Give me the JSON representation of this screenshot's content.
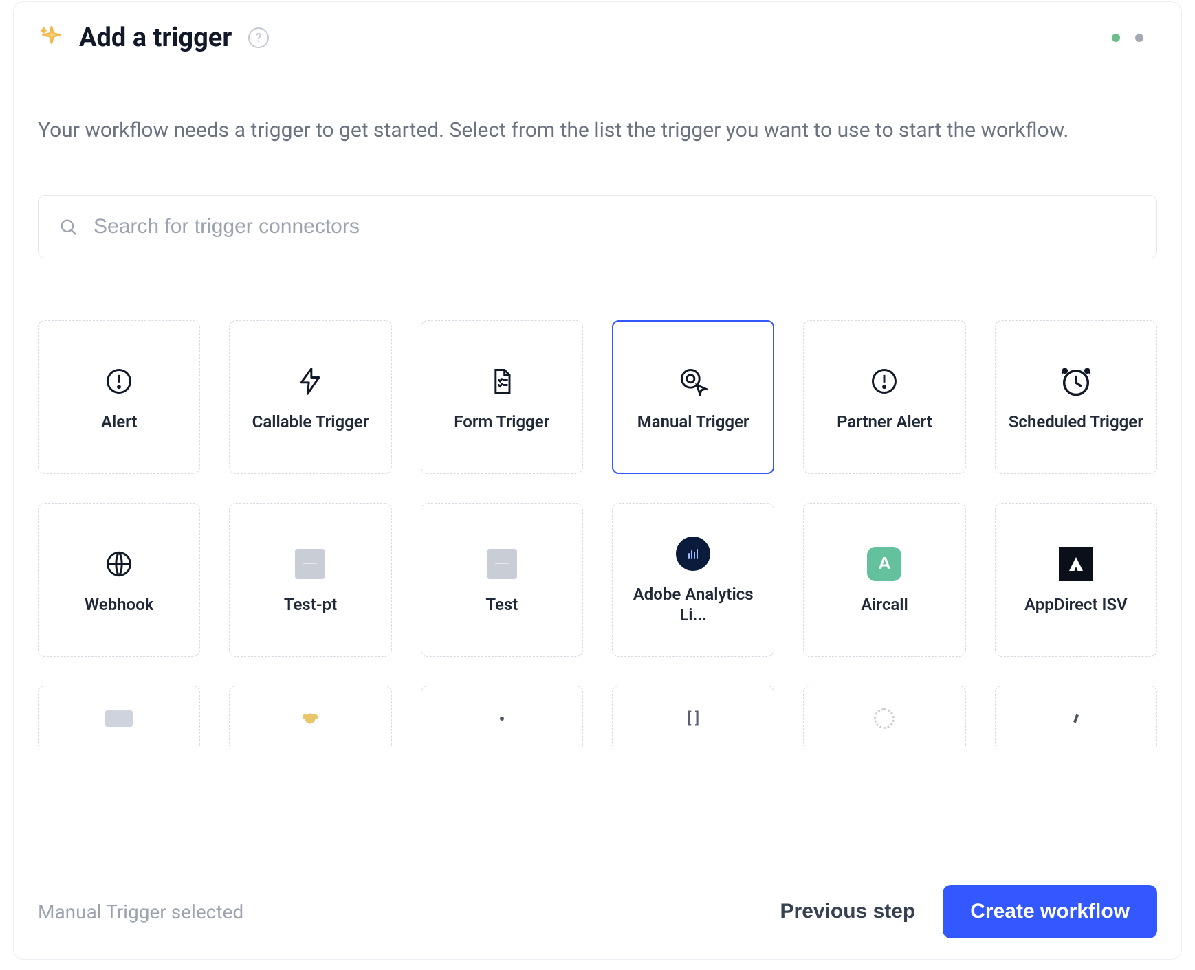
{
  "header": {
    "title": "Add a trigger",
    "description": "Your workflow needs a trigger to get started. Select from the list the trigger you want to use to start the workflow."
  },
  "search": {
    "placeholder": "Search for trigger connectors"
  },
  "triggers": [
    {
      "id": "alert",
      "label": "Alert",
      "icon": "alert-icon",
      "selected": false
    },
    {
      "id": "callable",
      "label": "Callable Trigger",
      "icon": "bolt-icon",
      "selected": false
    },
    {
      "id": "form",
      "label": "Form Trigger",
      "icon": "form-icon",
      "selected": false
    },
    {
      "id": "manual",
      "label": "Manual Trigger",
      "icon": "cursor-icon",
      "selected": true
    },
    {
      "id": "partner-alert",
      "label": "Partner Alert",
      "icon": "alert-icon",
      "selected": false
    },
    {
      "id": "scheduled",
      "label": "Scheduled Trigger",
      "icon": "clock-icon",
      "selected": false
    },
    {
      "id": "webhook",
      "label": "Webhook",
      "icon": "globe-icon",
      "selected": false
    },
    {
      "id": "test-pt",
      "label": "Test-pt",
      "icon": "grey-tile-icon",
      "selected": false
    },
    {
      "id": "test",
      "label": "Test",
      "icon": "grey-tile-icon",
      "selected": false
    },
    {
      "id": "adobe",
      "label": "Adobe Analytics Li...",
      "icon": "adobe-icon",
      "selected": false
    },
    {
      "id": "aircall",
      "label": "Aircall",
      "icon": "aircall-icon",
      "selected": false
    },
    {
      "id": "appdirect",
      "label": "AppDirect ISV",
      "icon": "appdirect-icon",
      "selected": false
    }
  ],
  "footer": {
    "selection_text": "Manual Trigger selected",
    "previous_label": "Previous step",
    "create_label": "Create workflow"
  }
}
